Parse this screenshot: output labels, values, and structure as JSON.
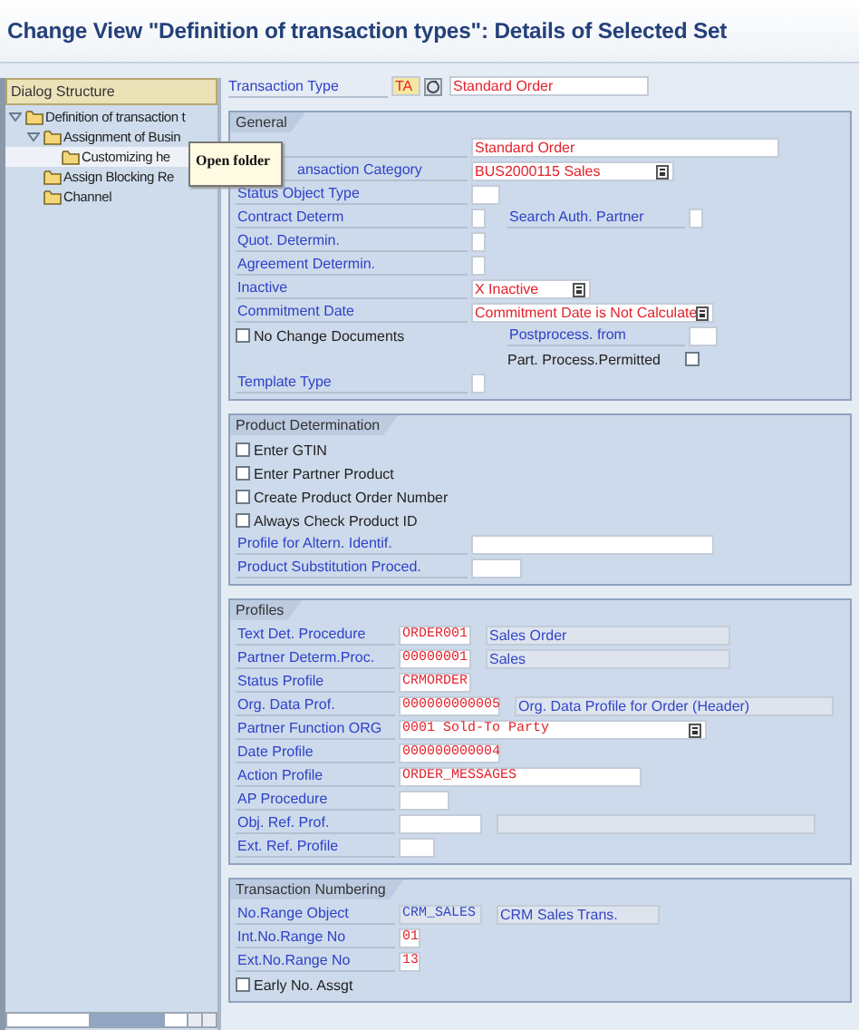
{
  "window": {
    "title": "Change View \"Definition of transaction types\": Details of Selected Set"
  },
  "tree": {
    "header": "Dialog Structure",
    "items": [
      {
        "label": "Definition of transaction t",
        "expanded": true,
        "selected": false,
        "children": [
          {
            "label": "Assignment of Busin",
            "expanded": true,
            "selected": false,
            "children": [
              {
                "label": "Customizing he",
                "selected": true
              }
            ]
          },
          {
            "label": "Assign Blocking Re",
            "selected": false
          },
          {
            "label": "Channel",
            "selected": false
          }
        ]
      }
    ]
  },
  "tooltip": {
    "text": "Open folder"
  },
  "header_field": {
    "label": "Transaction Type",
    "value": "TA",
    "description": "Standard Order"
  },
  "groups": [
    {
      "title": "General",
      "rows": [
        {
          "kind": "field",
          "value": "Standard Order"
        },
        {
          "kind": "field",
          "label": "ansaction Category",
          "covered": true,
          "value": "BUS2000115 Sales",
          "dropdown": true
        },
        {
          "kind": "field",
          "label": "Status Object Type"
        },
        {
          "kind": "field",
          "label": "Contract Determ",
          "side": {
            "kind": "field",
            "label": "Search Auth. Partner"
          }
        },
        {
          "kind": "field",
          "label": "Quot. Determin."
        },
        {
          "kind": "field",
          "label": "Agreement Determin."
        },
        {
          "kind": "field",
          "label": "Inactive",
          "value": "X Inactive",
          "dropdown": true
        },
        {
          "kind": "field",
          "label": "Commitment Date",
          "value": "Commitment Date is Not Calculate",
          "dropdown": true
        },
        {
          "kind": "check",
          "label": "No Change Documents",
          "checked": false,
          "side": {
            "kind": "field",
            "label": "Postprocess. from"
          }
        },
        {
          "kind": "blank",
          "side": {
            "kind": "check",
            "label": "Part. Process.Permitted",
            "checked": false
          }
        },
        {
          "kind": "field",
          "label": "Template Type"
        }
      ]
    },
    {
      "title": "Product Determination",
      "rows": [
        {
          "kind": "check",
          "label": "Enter GTIN",
          "checked": false
        },
        {
          "kind": "check",
          "label": "Enter Partner Product",
          "checked": false
        },
        {
          "kind": "check",
          "label": "Create Product Order Number",
          "checked": false
        },
        {
          "kind": "check",
          "label": "Always Check Product ID",
          "checked": false
        },
        {
          "kind": "field",
          "label": "Profile for Altern. Identif."
        },
        {
          "kind": "field",
          "label": "Product Substitution Proced."
        }
      ]
    },
    {
      "title": "Profiles",
      "rows": [
        {
          "kind": "field",
          "label": "Text Det. Procedure",
          "value": "ORDER001",
          "desc_field": true,
          "desc": "Sales Order"
        },
        {
          "kind": "field",
          "label": "Partner Determ.Proc.",
          "value": "00000001",
          "desc_field": true,
          "desc": "Sales"
        },
        {
          "kind": "field",
          "label": "Status Profile",
          "value": "CRMORDER"
        },
        {
          "kind": "field",
          "label": "Org. Data Prof.",
          "value": "000000000005",
          "desc_field": true,
          "desc": "Org. Data Profile for Order (Header)"
        },
        {
          "kind": "field",
          "label": "Partner Function ORG",
          "value": "0001 Sold-To Party",
          "dropdown": true
        },
        {
          "kind": "field",
          "label": "Date Profile",
          "value": "000000000004"
        },
        {
          "kind": "field",
          "label": "Action Profile",
          "value": "ORDER_MESSAGES"
        },
        {
          "kind": "field",
          "label": "AP Procedure"
        },
        {
          "kind": "field",
          "label": "Obj. Ref. Prof.",
          "desc_field": true
        },
        {
          "kind": "field",
          "label": "Ext. Ref. Profile"
        }
      ]
    },
    {
      "title": "Transaction Numbering",
      "rows": [
        {
          "kind": "field",
          "label": "No.Range Object",
          "value": "CRM_SALES",
          "readonly": true,
          "desc_field": true,
          "desc": "CRM Sales Trans."
        },
        {
          "kind": "field",
          "label": "Int.No.Range No",
          "value": "01"
        },
        {
          "kind": "field",
          "label": "Ext.No.Range No",
          "value": "13"
        },
        {
          "kind": "check",
          "label": "Early No. Assgt",
          "checked": false
        }
      ]
    }
  ]
}
